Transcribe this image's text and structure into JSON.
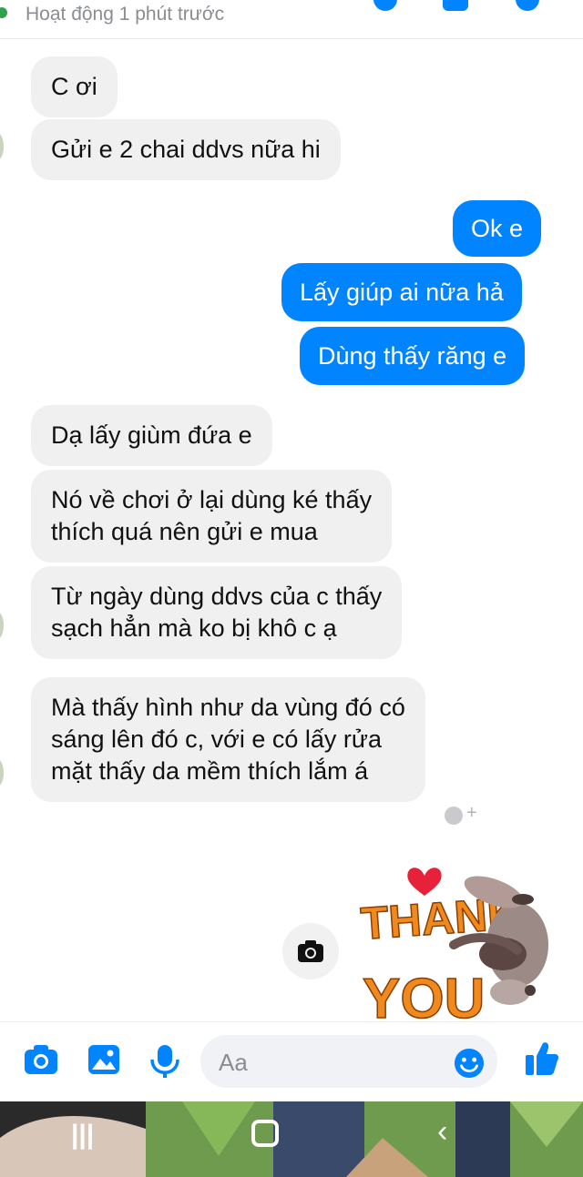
{
  "header": {
    "status": "Hoạt động 1 phút trước"
  },
  "messages": [
    {
      "side": "in",
      "text": "C ơi"
    },
    {
      "side": "in",
      "text": "Gửi e 2 chai ddvs nữa hi"
    },
    {
      "side": "out",
      "text": "Ok e"
    },
    {
      "side": "out",
      "text": "Lấy giúp ai nữa hả"
    },
    {
      "side": "out",
      "text": "Dùng thấy răng e"
    },
    {
      "side": "in",
      "text": "Dạ lấy giùm đứa e"
    },
    {
      "side": "in",
      "lines": [
        "Nó về chơi ở lại dùng ké thấy",
        "thích quá nên gửi e mua"
      ]
    },
    {
      "side": "in",
      "lines": [
        "Từ ngày dùng ddvs của c thấy",
        "sạch hẳn mà ko bị khô c ạ"
      ]
    },
    {
      "side": "in",
      "lines": [
        "Mà thấy hình như da vùng đó có",
        "sáng lên đó c, với e có lấy rửa",
        "mặt thấy da mềm thích lắm á"
      ]
    }
  ],
  "sticker": {
    "line1": "THANK",
    "line2": "YOU"
  },
  "composer": {
    "placeholder": "Aa"
  },
  "colors": {
    "accent": "#0084ff",
    "incoming_bubble": "#f0f0f0",
    "online": "#31a24c"
  },
  "icons": [
    "camera-icon",
    "image-icon",
    "microphone-icon",
    "emoji-icon",
    "thumbs-up-icon",
    "recents-icon",
    "home-icon",
    "back-icon",
    "add-reaction-icon"
  ]
}
